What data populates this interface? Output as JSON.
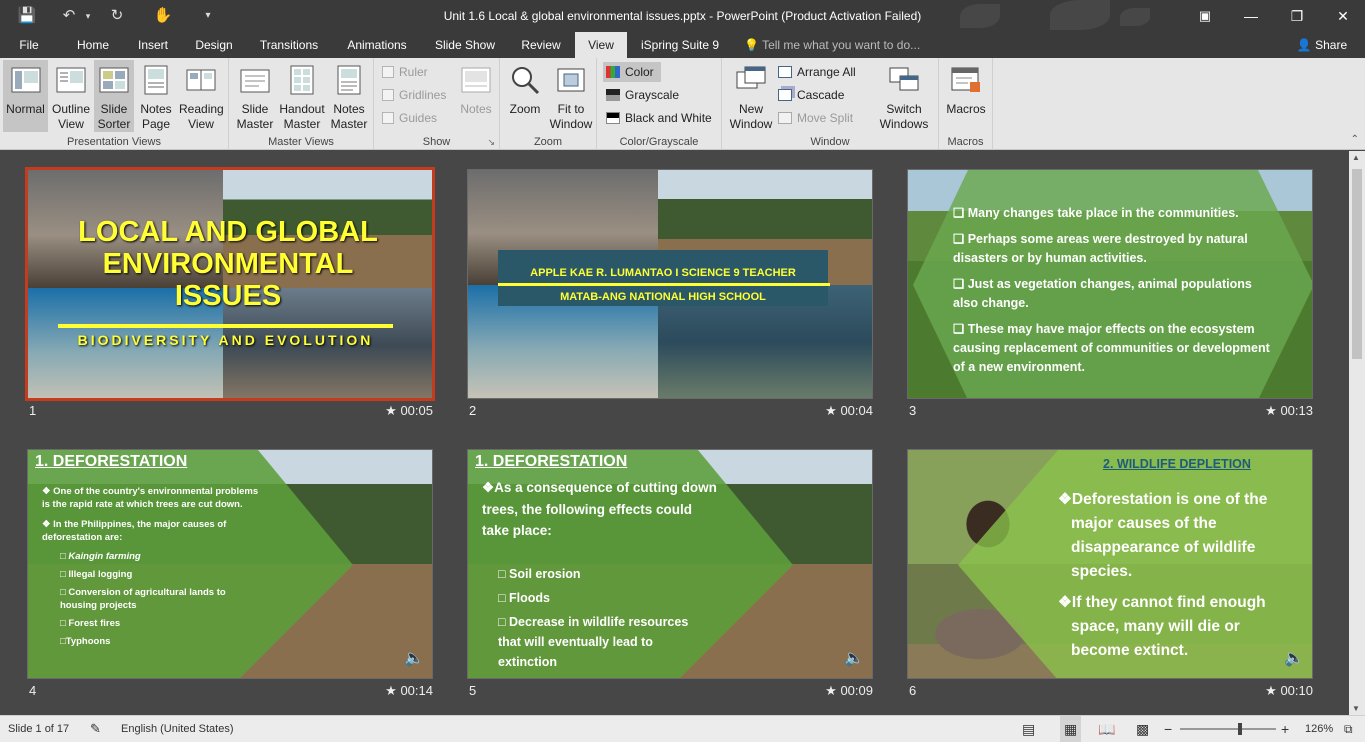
{
  "window": {
    "title": "Unit 1.6 Local & global environmental issues.pptx - PowerPoint (Product Activation Failed)"
  },
  "quick_access": [
    "save-icon",
    "undo-icon",
    "redo-icon",
    "touch-mode-icon",
    "customize-icon"
  ],
  "tabs": [
    "File",
    "Home",
    "Insert",
    "Design",
    "Transitions",
    "Animations",
    "Slide Show",
    "Review",
    "View",
    "iSpring Suite 9"
  ],
  "active_tab": "View",
  "tell_me": "Tell me what you want to do...",
  "share": "Share",
  "ribbon": {
    "presentation_views": {
      "label": "Presentation Views",
      "buttons": [
        "Normal",
        "Outline View",
        "Slide Sorter",
        "Notes Page",
        "Reading View"
      ]
    },
    "master_views": {
      "label": "Master Views",
      "buttons": [
        "Slide Master",
        "Handout Master",
        "Notes Master"
      ]
    },
    "show": {
      "label": "Show",
      "checks": [
        "Ruler",
        "Gridlines",
        "Guides"
      ],
      "notes": "Notes"
    },
    "zoom": {
      "label": "Zoom",
      "buttons": [
        "Zoom",
        "Fit to Window"
      ]
    },
    "color": {
      "label": "Color/Grayscale",
      "options": [
        "Color",
        "Grayscale",
        "Black and White"
      ]
    },
    "window": {
      "label": "Window",
      "new_window": "New Window",
      "small": [
        "Arrange All",
        "Cascade",
        "Move Split"
      ],
      "switch": "Switch Windows"
    },
    "macros": {
      "label": "Macros",
      "button": "Macros"
    }
  },
  "slides": [
    {
      "num": "1",
      "time": "00:05",
      "title": "LOCAL AND GLOBAL ENVIRONMENTAL ISSUES",
      "subtitle": "BIODIVERSITY AND EVOLUTION"
    },
    {
      "num": "2",
      "time": "00:04",
      "line1": "APPLE KAE R. LUMANTAO I SCIENCE 9 TEACHER",
      "line2": "MATAB-ANG NATIONAL HIGH SCHOOL"
    },
    {
      "num": "3",
      "time": "00:13",
      "bullets": [
        "Many changes take place in the communities.",
        "Perhaps some areas were destroyed by natural disasters or by human activities.",
        "Just as vegetation changes, animal populations also change.",
        "These may have major effects on the ecosystem causing replacement of communities or development of a new environment."
      ]
    },
    {
      "num": "4",
      "time": "00:14",
      "heading": "1. DEFORESTATION",
      "bullets": [
        "One of the country's environmental problems is the rapid rate at which trees are cut down.",
        "In the Philippines, the major causes of deforestation are:"
      ],
      "sub": [
        "Kaingin farming",
        "Illegal logging",
        "Conversion of agricultural lands to housing projects",
        "Forest fires",
        "Typhoons"
      ]
    },
    {
      "num": "5",
      "time": "00:09",
      "heading": "1. DEFORESTATION",
      "lead": "As a consequence of cutting down trees, the following effects could take place:",
      "sub": [
        "Soil erosion",
        "Floods",
        "Decrease in wildlife resources that will eventually lead to extinction"
      ]
    },
    {
      "num": "6",
      "time": "00:10",
      "heading": "2. WILDLIFE DEPLETION",
      "bullets": [
        "Deforestation is one of the major causes of the disappearance of wildlife species.",
        "If they cannot find enough space, many will die or become extinct."
      ]
    }
  ],
  "status": {
    "slide": "Slide 1 of 17",
    "language": "English (United States)",
    "zoom": "126%",
    "zoom_level": 0.62
  },
  "colors": {
    "accent": "#c43b1d",
    "dark": "#3a3a3a",
    "ribbon": "#e6e6e6",
    "workspace": "#474747"
  }
}
